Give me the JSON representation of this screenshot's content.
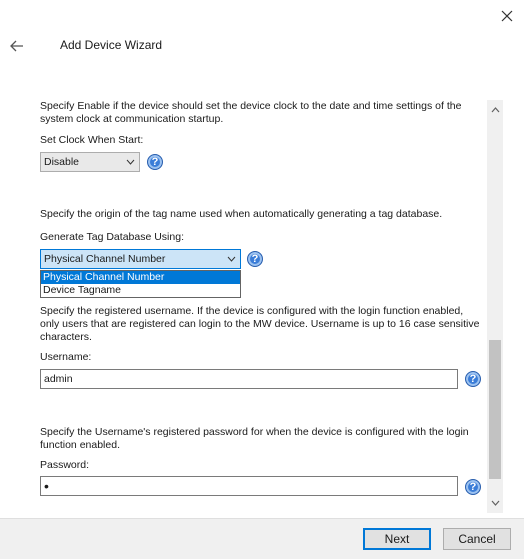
{
  "header": {
    "title": "Add Device Wizard"
  },
  "clock": {
    "description": "Specify Enable if the device should set the device clock to the date and time settings of the system clock at communication startup.",
    "label": "Set Clock When Start:",
    "value": "Disable"
  },
  "tagdb": {
    "description": "Specify the origin of the tag name used when automatically generating a tag database.",
    "label": "Generate Tag Database Using:",
    "value": "Physical Channel Number",
    "options": [
      "Physical Channel Number",
      "Device Tagname"
    ]
  },
  "username": {
    "description": "Specify the registered username. If the device is configured with the login function enabled, only users that are registered can login to the MW device. Username is up to 16 case sensitive characters.",
    "label": "Username:",
    "value": "admin"
  },
  "password": {
    "description": "Specify the Username's registered password for when the device is configured with the login function enabled.",
    "label": "Password:",
    "value": "•"
  },
  "footer": {
    "next_label": "Next",
    "cancel_label": "Cancel"
  },
  "colors": {
    "accent": "#0078d7",
    "help_icon": "#3b7dd8",
    "footer_bg": "#f0f0f0"
  }
}
